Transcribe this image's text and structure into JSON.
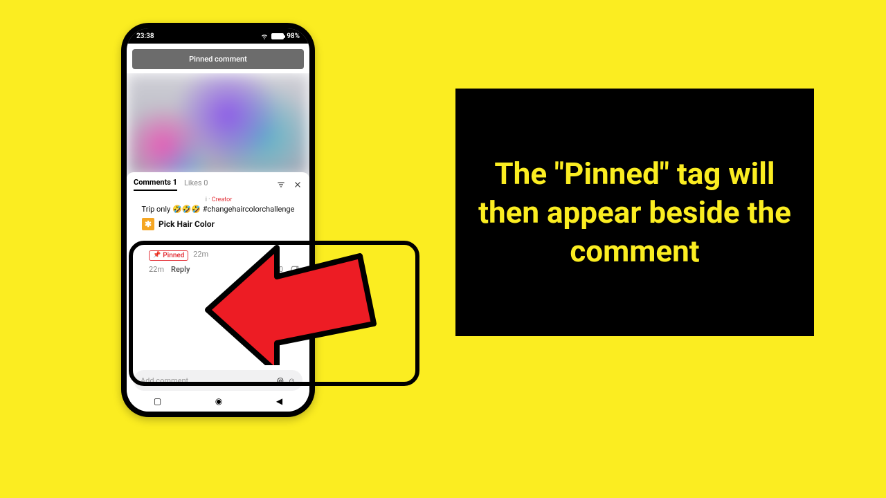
{
  "statusbar": {
    "time": "23:38",
    "battery": "98%"
  },
  "banner": {
    "text": "Pinned comment"
  },
  "sheet": {
    "tabs": {
      "comments_label": "Comments 1",
      "likes_label": "Likes 0"
    },
    "creator_tag_prefix": "i ·",
    "creator_tag": "Creator",
    "comment_text": "Trip only 🤣🤣🤣 #changehaircolorchallenge",
    "pick_hair_label": "Pick Hair Color"
  },
  "comment": {
    "pinned_label": "Pinned",
    "time_after": "22m",
    "meta_time": "22m",
    "reply_label": "Reply",
    "heart_count": "0"
  },
  "input": {
    "placeholder": "Add comment...",
    "at": "@",
    "emoji": "☺"
  },
  "instruction": {
    "text": "The \"Pinned\" tag will then appear beside the comment"
  }
}
